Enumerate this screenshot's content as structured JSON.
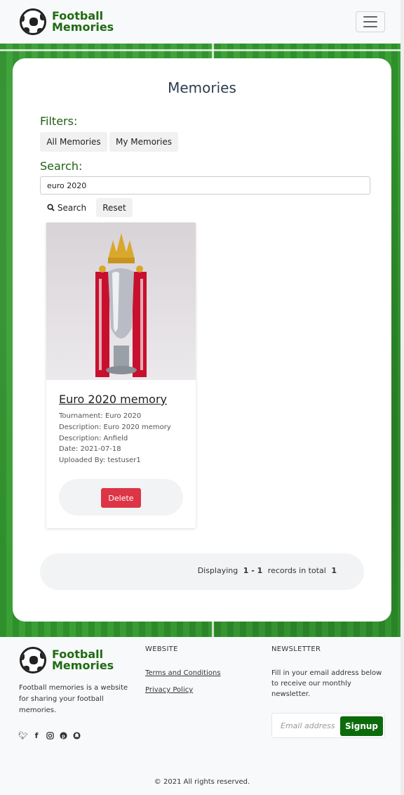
{
  "brand": {
    "line1": "Football",
    "line2": "Memories",
    "color": "#1f6b12"
  },
  "navbar": {
    "menu_icon": "hamburger-icon"
  },
  "page": {
    "title": "Memories"
  },
  "filters": {
    "label": "Filters:",
    "all": "All Memories",
    "mine": "My Memories"
  },
  "search": {
    "label": "Search:",
    "value": "euro 2020",
    "search_button": "Search",
    "reset_button": "Reset",
    "icon": "search-icon"
  },
  "memories": [
    {
      "title": "Euro 2020 memory",
      "tournament": "Tournament: Euro 2020",
      "description": "Description: Euro 2020 memory",
      "location": "Description: Anfield",
      "date": "Date: 2021-07-18",
      "uploaded_by": "Uploaded By: testuser1",
      "delete_label": "Delete"
    }
  ],
  "pagination": {
    "prefix": "Displaying",
    "range": "1 - 1",
    "middle": "records in total",
    "total": "1"
  },
  "footer": {
    "description": "Football memories is a website for sharing your football memories.",
    "website_heading": "WEBSITE",
    "links": [
      "Terms and Conditions",
      "Privacy Policy"
    ],
    "newsletter_heading": "NEWSLETTER",
    "newsletter_text": "Fill in your email address below to receive our monthly newsletter.",
    "email_placeholder": "Email address",
    "signup_label": "Signup",
    "copyright": "© 2021 All rights reserved.",
    "socials": [
      "twitter-icon",
      "facebook-icon",
      "instagram-icon",
      "pinterest-icon",
      "snapchat-icon"
    ]
  },
  "colors": {
    "accent": "#0b6b0b",
    "danger": "#dc3545",
    "label_green": "#1f5f12"
  }
}
